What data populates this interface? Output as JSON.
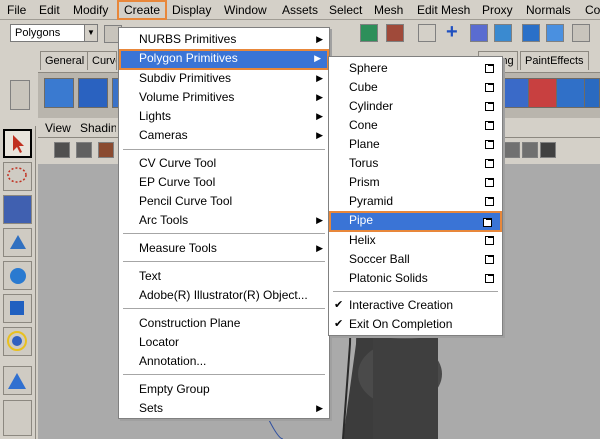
{
  "menubar": {
    "items": [
      "File",
      "Edit",
      "Modify",
      "Create",
      "Display",
      "Window",
      "Assets",
      "Select",
      "Mesh",
      "Edit Mesh",
      "Proxy",
      "Normals",
      "Co"
    ],
    "active": "Create"
  },
  "mode_selector": {
    "value": "Polygons"
  },
  "shelf_tabs": [
    "General",
    "Curve",
    "dering",
    "PaintEffects"
  ],
  "viewport_menu": {
    "items": [
      "View",
      "Shadin"
    ]
  },
  "create_menu": {
    "items": [
      {
        "label": "NURBS Primitives",
        "submenu": true
      },
      {
        "label": "Polygon Primitives",
        "submenu": true
      },
      {
        "label": "Subdiv Primitives",
        "submenu": true
      },
      {
        "label": "Volume Primitives",
        "submenu": true
      },
      {
        "label": "Lights",
        "submenu": true
      },
      {
        "label": "Cameras",
        "submenu": true
      },
      {
        "label": "CV Curve Tool"
      },
      {
        "label": "EP Curve Tool"
      },
      {
        "label": "Pencil Curve Tool"
      },
      {
        "label": "Arc Tools",
        "submenu": true
      },
      {
        "label": "Measure Tools",
        "submenu": true
      },
      {
        "label": "Text"
      },
      {
        "label": "Adobe(R) Illustrator(R) Object..."
      },
      {
        "label": "Construction Plane"
      },
      {
        "label": "Locator"
      },
      {
        "label": "Annotation..."
      },
      {
        "label": "Empty Group"
      },
      {
        "label": "Sets",
        "submenu": true
      }
    ]
  },
  "polygon_submenu": {
    "items": [
      "Sphere",
      "Cube",
      "Cylinder",
      "Cone",
      "Plane",
      "Torus",
      "Prism",
      "Pyramid",
      "Pipe",
      "Helix",
      "Soccer Ball",
      "Platonic Solids"
    ],
    "checked": [
      "Interactive Creation",
      "Exit On Completion"
    ]
  },
  "colors": {
    "highlight": "#3a74d6",
    "outline": "#e8873a"
  }
}
